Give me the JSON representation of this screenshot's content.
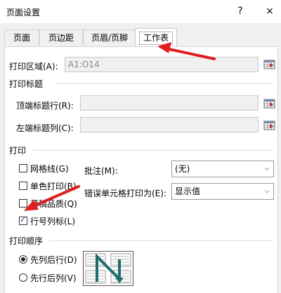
{
  "window": {
    "title": "页面设置",
    "help": "?",
    "close": "×"
  },
  "tabs": [
    "页面",
    "页边距",
    "页眉/页脚",
    "工作表"
  ],
  "print_area": {
    "label": "打印区域(A):",
    "value": "A1:O14"
  },
  "print_titles": {
    "group": "打印标题",
    "rows_label": "顶端标题行(R):",
    "cols_label": "左端标题列(C):"
  },
  "print": {
    "group": "打印",
    "gridlines": "网格线(G)",
    "mono": "单色打印(B)",
    "draft": "草稿品质(Q)",
    "headings": "行号列标(L)",
    "comments_label": "批注(M):",
    "comments_value": "(无)",
    "errors_label": "错误单元格打印为(E):",
    "errors_value": "显示值"
  },
  "order": {
    "group": "打印顺序",
    "down_then_over": "先列后行(D)",
    "over_then_down": "先行后列(V)"
  },
  "colors": {
    "arrow": "#e02020",
    "preview_stroke": "#1f6e6e"
  }
}
